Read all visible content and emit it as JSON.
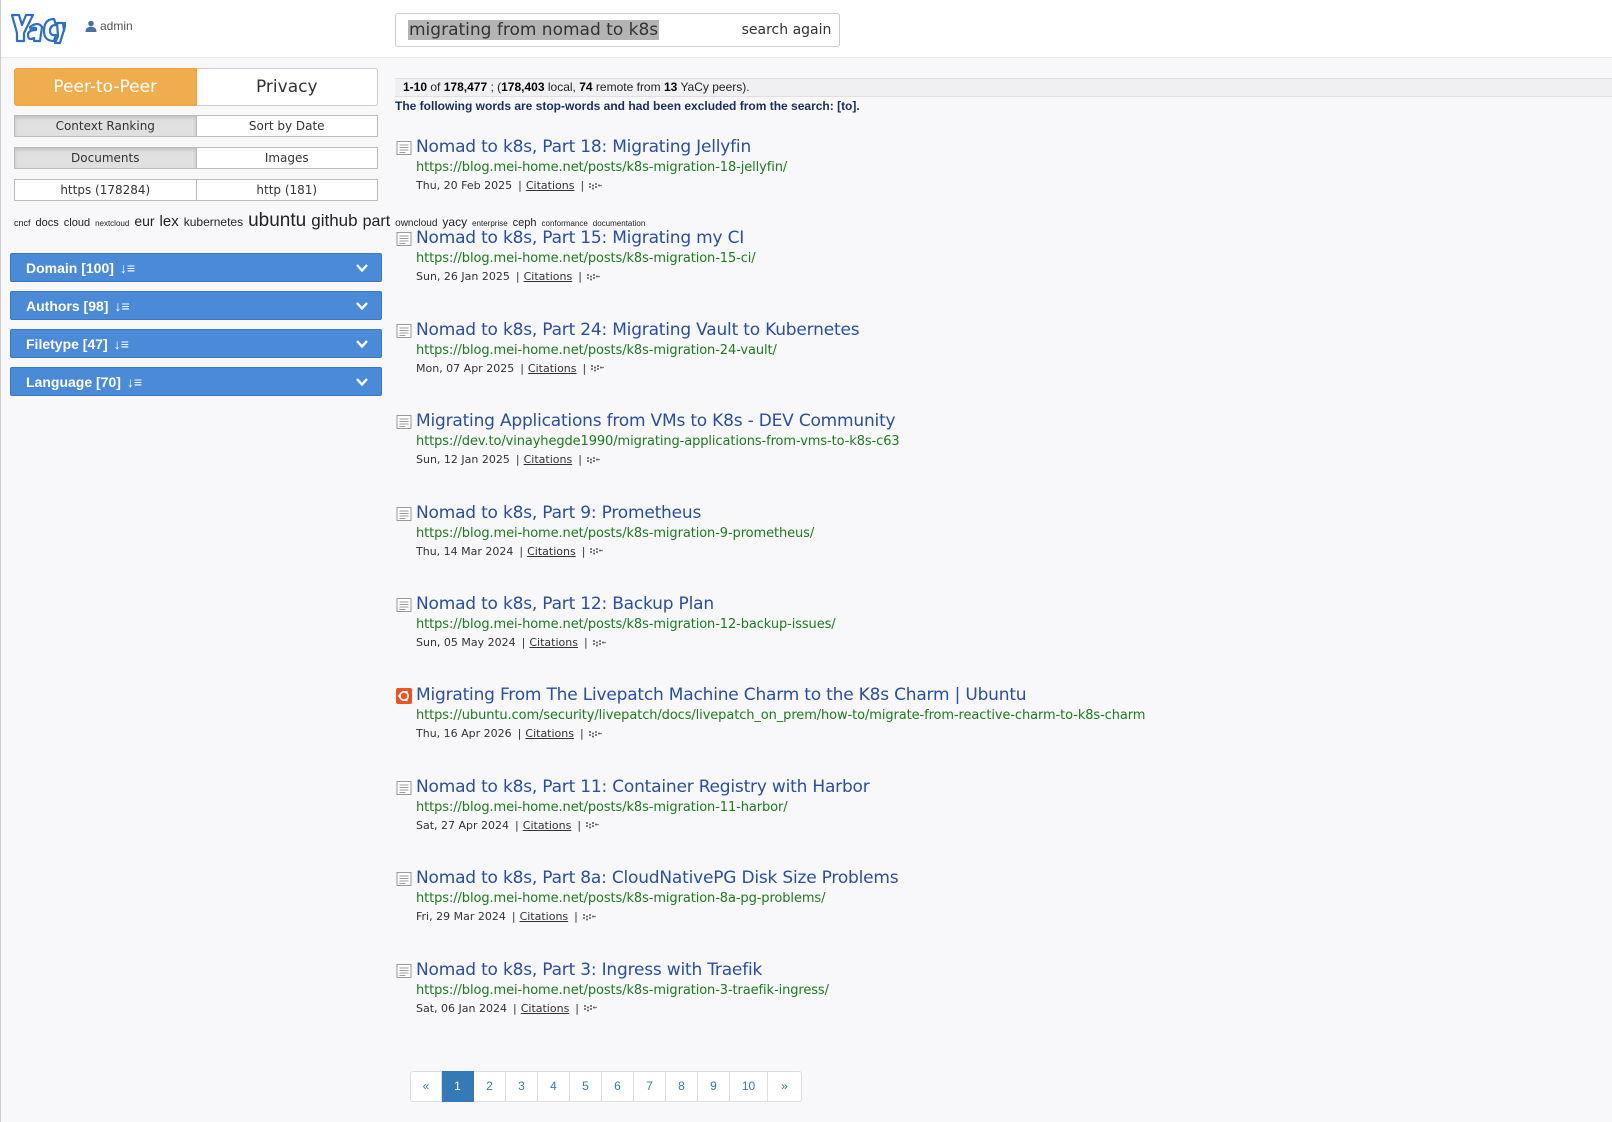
{
  "header": {
    "user": "admin",
    "search_query": "migrating from nomad to k8s",
    "search_button": "search again"
  },
  "sidebar": {
    "network_toggle": [
      "Peer-to-Peer",
      "Privacy"
    ],
    "ranking": [
      "Context Ranking",
      "Sort by Date"
    ],
    "content_type": [
      "Documents",
      "Images"
    ],
    "protocol": [
      "https (178284)",
      "http (181)"
    ],
    "tags": [
      {
        "text": "cncf",
        "size": 9
      },
      {
        "text": "docs",
        "size": 11
      },
      {
        "text": "cloud",
        "size": 11
      },
      {
        "text": "nextcloud",
        "size": 8
      },
      {
        "text": "eur",
        "size": 14
      },
      {
        "text": "lex",
        "size": 15
      },
      {
        "text": "kubernetes",
        "size": 12
      },
      {
        "text": "ubuntu",
        "size": 19
      },
      {
        "text": "github",
        "size": 17
      },
      {
        "text": "part",
        "size": 16
      },
      {
        "text": "owncloud",
        "size": 10
      },
      {
        "text": "yacy",
        "size": 12
      },
      {
        "text": "enterprise",
        "size": 8
      },
      {
        "text": "ceph",
        "size": 11
      },
      {
        "text": "conformance",
        "size": 8
      },
      {
        "text": "documentation",
        "size": 8
      }
    ],
    "facets": [
      "Domain [100]",
      "Authors [98]",
      "Filetype [47]",
      "Language [70]"
    ]
  },
  "summary": {
    "range": "1-10",
    "of": "of",
    "total": "178,477",
    "sep": " ; (",
    "local": "178,403",
    "local_label": "local,",
    "remote": "74",
    "remote_label": "remote from",
    "peers": "13",
    "peers_label": "YaCy peers).",
    "stopwords": "The following words are stop-words and had been excluded from the search: [to]."
  },
  "results": [
    {
      "title": "Nomad to k8s, Part 18: Migrating Jellyfin",
      "url": "https://blog.mei-home.net/posts/k8s-migration-18-jellyfin/",
      "date": "Thu, 20 Feb 2025",
      "icon": "page"
    },
    {
      "title": "Nomad to k8s, Part 15: Migrating my CI",
      "url": "https://blog.mei-home.net/posts/k8s-migration-15-ci/",
      "date": "Sun, 26 Jan 2025",
      "icon": "page"
    },
    {
      "title": "Nomad to k8s, Part 24: Migrating Vault to Kubernetes",
      "url": "https://blog.mei-home.net/posts/k8s-migration-24-vault/",
      "date": "Mon, 07 Apr 2025",
      "icon": "page"
    },
    {
      "title": "Migrating Applications from VMs to K8s - DEV Community",
      "url": "https://dev.to/vinayhegde1990/migrating-applications-from-vms-to-k8s-c63",
      "date": "Sun, 12 Jan 2025",
      "icon": "page"
    },
    {
      "title": "Nomad to k8s, Part 9: Prometheus",
      "url": "https://blog.mei-home.net/posts/k8s-migration-9-prometheus/",
      "date": "Thu, 14 Mar 2024",
      "icon": "page"
    },
    {
      "title": "Nomad to k8s, Part 12: Backup Plan",
      "url": "https://blog.mei-home.net/posts/k8s-migration-12-backup-issues/",
      "date": "Sun, 05 May 2024",
      "icon": "page"
    },
    {
      "title": "Migrating From The Livepatch Machine Charm to the K8s Charm | Ubuntu",
      "url": "https://ubuntu.com/security/livepatch/docs/livepatch_on_prem/how-to/migrate-from-reactive-charm-to-k8s-charm",
      "date": "Thu, 16 Apr 2026",
      "icon": "ubuntu"
    },
    {
      "title": "Nomad to k8s, Part 11: Container Registry with Harbor",
      "url": "https://blog.mei-home.net/posts/k8s-migration-11-harbor/",
      "date": "Sat, 27 Apr 2024",
      "icon": "page"
    },
    {
      "title": "Nomad to k8s, Part 8a: CloudNativePG Disk Size Problems",
      "url": "https://blog.mei-home.net/posts/k8s-migration-8a-pg-problems/",
      "date": "Fri, 29 Mar 2024",
      "icon": "page"
    },
    {
      "title": "Nomad to k8s, Part 3: Ingress with Traefik",
      "url": "https://blog.mei-home.net/posts/k8s-migration-3-traefik-ingress/",
      "date": "Sat, 06 Jan 2024",
      "icon": "page"
    }
  ],
  "result_meta": {
    "citations": "Citations",
    "pipe": "|"
  },
  "pagination": {
    "prev": "«",
    "pages": [
      "1",
      "2",
      "3",
      "4",
      "5",
      "6",
      "7",
      "8",
      "9",
      "10"
    ],
    "current": "1",
    "next": "»"
  },
  "colors": {
    "peer_toggle": "#f0ad4e",
    "facet_bar": "#4a8ad6",
    "title_link": "#2a4ea0",
    "url_green": "#1e7a1e",
    "ubuntu_orange": "#e95420"
  }
}
